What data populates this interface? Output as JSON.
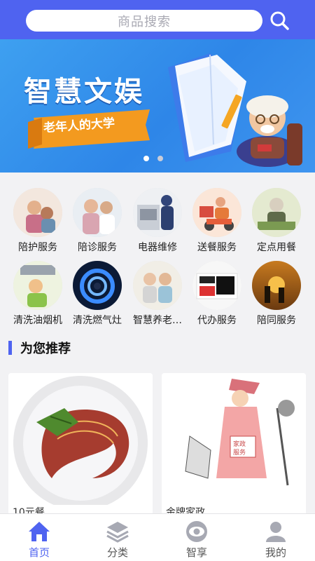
{
  "search": {
    "placeholder": "商品搜索"
  },
  "banner": {
    "title": "智慧文娱",
    "subtitle": "老年人的大学",
    "dots": 2,
    "active_dot": 0
  },
  "services": [
    {
      "label": "陪护服务",
      "icon": "caregiver-photo"
    },
    {
      "label": "陪诊服务",
      "icon": "doctor-photo"
    },
    {
      "label": "电器维修",
      "icon": "repair-photo"
    },
    {
      "label": "送餐服务",
      "icon": "delivery-photo"
    },
    {
      "label": "定点用餐",
      "icon": "dining-photo"
    },
    {
      "label": "清洗油烟机",
      "icon": "range-hood-photo"
    },
    {
      "label": "清洗燃气灶",
      "icon": "gas-stove-photo"
    },
    {
      "label": "智慧养老…",
      "icon": "elderly-photo"
    },
    {
      "label": "代办服务",
      "icon": "errand-photo"
    },
    {
      "label": "陪同服务",
      "icon": "companion-photo"
    }
  ],
  "section": {
    "title": "为您推荐"
  },
  "cards": [
    {
      "title": "10元餐",
      "image": "meal-plate"
    },
    {
      "title": "金牌家政",
      "image": "housekeeping-illustration"
    }
  ],
  "tabbar": [
    {
      "label": "首页",
      "icon": "home-icon",
      "active": true
    },
    {
      "label": "分类",
      "icon": "layers-icon",
      "active": false
    },
    {
      "label": "智享",
      "icon": "eye-icon",
      "active": false
    },
    {
      "label": "我的",
      "icon": "user-icon",
      "active": false
    }
  ],
  "colors": {
    "accent": "#4f63f0",
    "banner": "#3ea0f0"
  }
}
